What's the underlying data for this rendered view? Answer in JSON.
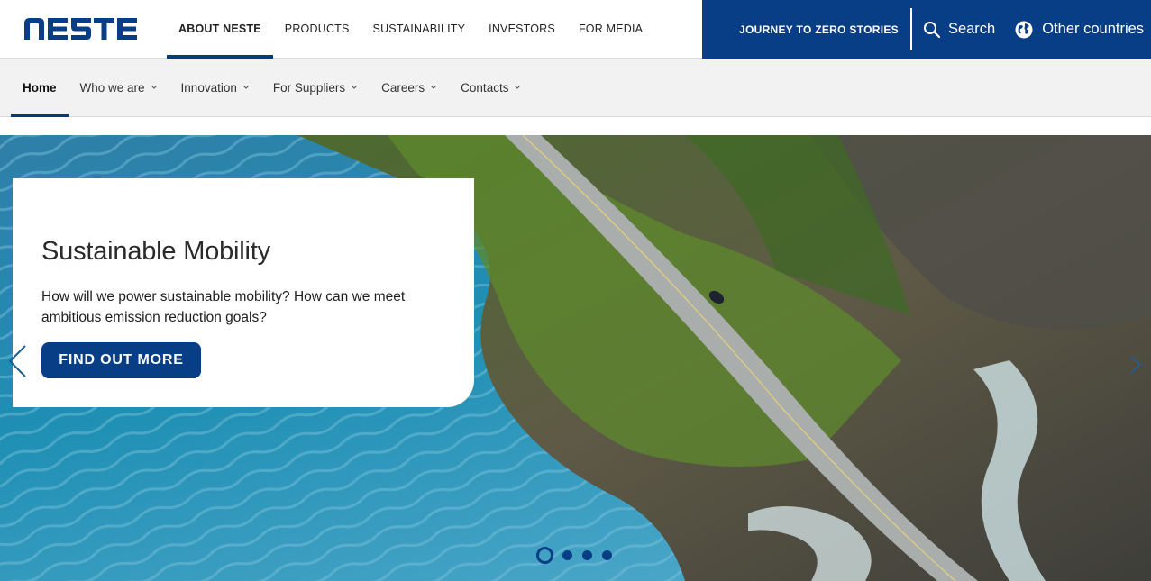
{
  "brand": {
    "logo_text": "NESTE",
    "color_primary": "#073e86"
  },
  "main_nav": {
    "items": [
      {
        "label": "ABOUT NESTE",
        "active": true
      },
      {
        "label": "PRODUCTS"
      },
      {
        "label": "SUSTAINABILITY"
      },
      {
        "label": "INVESTORS"
      },
      {
        "label": "FOR MEDIA"
      }
    ]
  },
  "utility": {
    "journey_label": "JOURNEY TO ZERO STORIES",
    "search_label": "Search",
    "countries_label": "Other countries"
  },
  "sub_nav": {
    "items": [
      {
        "label": "Home",
        "active": true
      },
      {
        "label": "Who we are",
        "has_dropdown": true
      },
      {
        "label": "Innovation",
        "has_dropdown": true
      },
      {
        "label": "For Suppliers",
        "has_dropdown": true
      },
      {
        "label": "Careers",
        "has_dropdown": true
      },
      {
        "label": "Contacts",
        "has_dropdown": true
      }
    ]
  },
  "hero": {
    "title": "Sustainable Mobility",
    "text": "How will we power sustainable mobility? How can we meet ambitious emission reduction goals?",
    "cta_label": "FIND OUT MORE",
    "slides_count": 4,
    "active_slide": 1
  },
  "icons": {
    "search": "search-icon",
    "globe": "globe-icon",
    "chevron": "chevron-down-icon",
    "prev": "chevron-left-icon",
    "next": "chevron-right-icon"
  }
}
